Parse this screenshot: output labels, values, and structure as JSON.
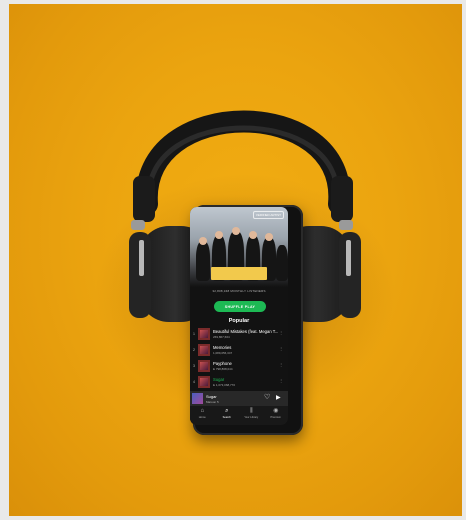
{
  "scene": {
    "background_color": "#eba40f",
    "objects": [
      "black over-ear headphones",
      "smartphone"
    ]
  },
  "phone_screen": {
    "app": "music-streaming",
    "header_badge": "VERIFIED ARTIST",
    "listeners_text": "32,808,348 MONTHLY LISTENERS",
    "shuffle_label": "SHUFFLE PLAY",
    "section_title": "Popular",
    "tracks": [
      {
        "num": "1",
        "title": "Beautiful Mistakes (feat. Megan T...",
        "plays": "269,867,664"
      },
      {
        "num": "2",
        "title": "Memories",
        "plays": "1,089,056,347"
      },
      {
        "num": "3",
        "title": "Payphone",
        "plays": "E 798,868,044"
      },
      {
        "num": "4",
        "title": "Sugar",
        "plays": "E 1,073,068,770"
      }
    ],
    "now_playing": {
      "title": "Sugar",
      "artist": "Maroon 5",
      "like_icon": "heart-icon",
      "play_icon": "play-icon"
    },
    "nav": [
      {
        "label": "Home",
        "icon": "home-icon"
      },
      {
        "label": "Search",
        "icon": "search-icon"
      },
      {
        "label": "Your Library",
        "icon": "library-icon"
      },
      {
        "label": "Premium",
        "icon": "premium-icon"
      }
    ],
    "accent_color": "#1db954",
    "redaction_color": "#f2c94c"
  }
}
